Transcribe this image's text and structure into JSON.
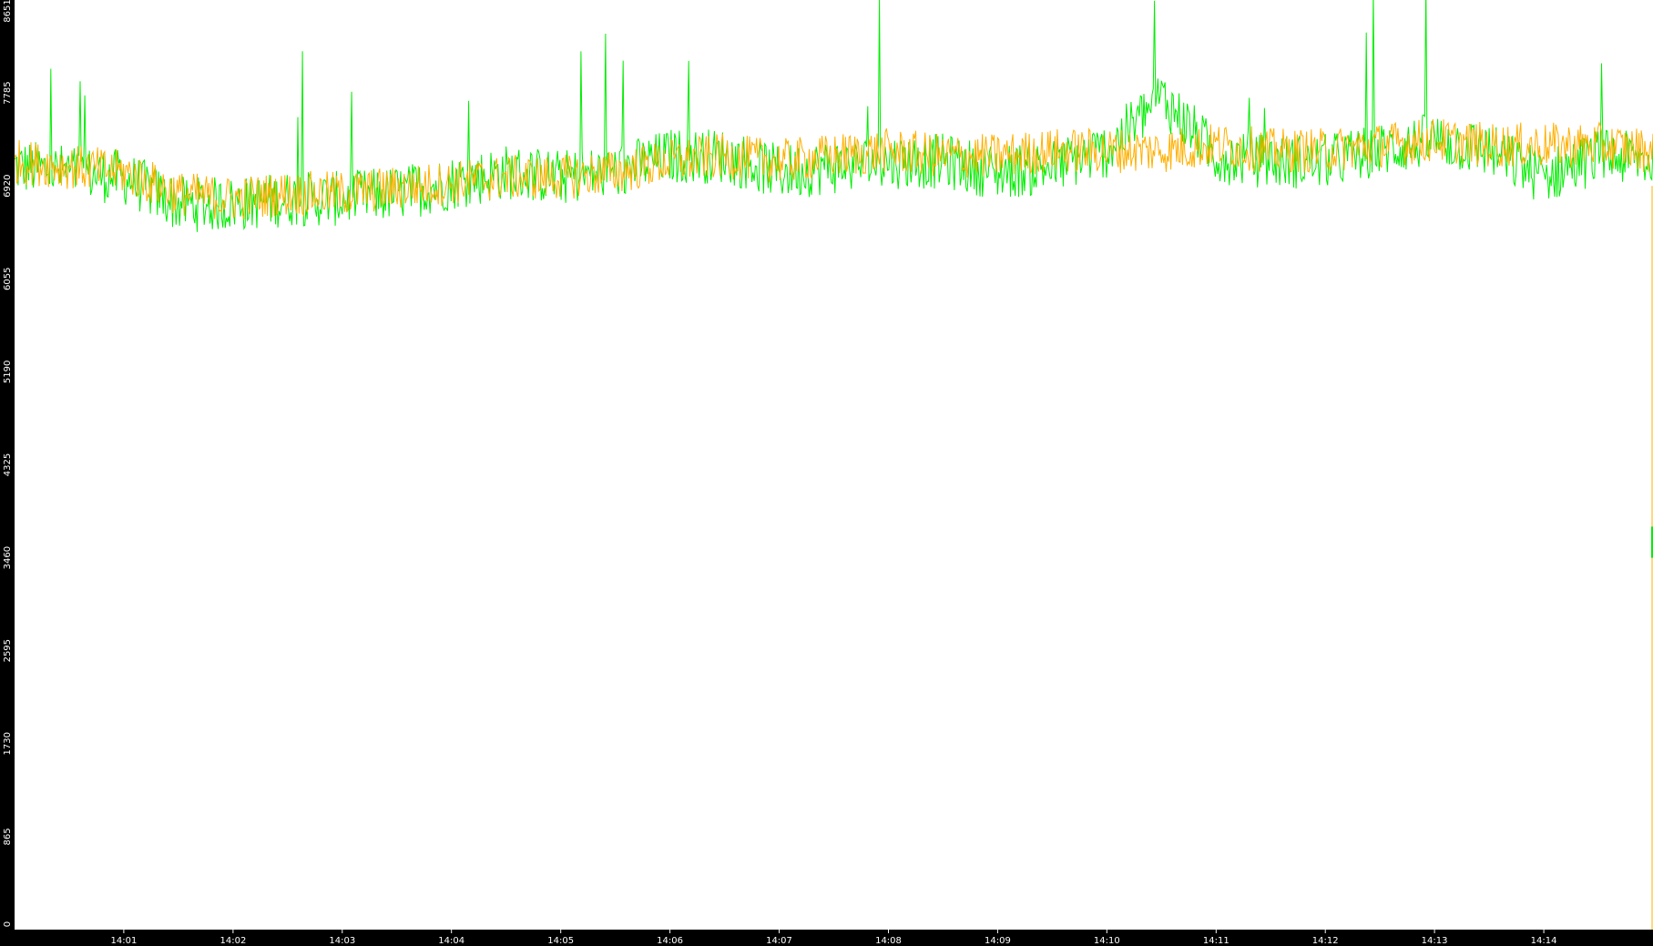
{
  "chart_data": {
    "type": "line",
    "title": "",
    "xlabel": "",
    "ylabel": "",
    "ylim": [
      0,
      8651
    ],
    "xlim": [
      "14:00:00",
      "14:15:00"
    ],
    "grid": false,
    "legend": "none",
    "colors": {
      "background": "#ffffff",
      "frame": "#000000",
      "tick_text": "#ffffff",
      "series_green": "#00ee00",
      "series_orange": "#ffb000"
    },
    "y_ticks": [
      "0",
      "865",
      "1730",
      "2595",
      "3460",
      "4325",
      "5190",
      "6055",
      "6920",
      "7785",
      "8651"
    ],
    "x_ticks": [
      "14:01",
      "14:02",
      "14:03",
      "14:04",
      "14:05",
      "14:06",
      "14:07",
      "14:08",
      "14:09",
      "14:10",
      "14:11",
      "14:12",
      "14:13",
      "14:14"
    ],
    "series": [
      {
        "color": "#00ee00",
        "x": [
          "14:00:00",
          "14:00:30",
          "14:01:00",
          "14:01:30",
          "14:02:00",
          "14:02:30",
          "14:03:00",
          "14:03:30",
          "14:04:00",
          "14:04:30",
          "14:05:00",
          "14:05:30",
          "14:06:00",
          "14:06:30",
          "14:07:00",
          "14:07:30",
          "14:08:00",
          "14:08:30",
          "14:09:00",
          "14:09:30",
          "14:10:00",
          "14:10:30",
          "14:11:00",
          "14:11:30",
          "14:12:00",
          "14:12:30",
          "14:13:00",
          "14:13:30",
          "14:14:00",
          "14:14:30",
          "14:15:00"
        ],
        "values": [
          7100,
          7050,
          7000,
          6750,
          6750,
          6800,
          6800,
          6850,
          6950,
          7050,
          7000,
          7050,
          7200,
          7200,
          7050,
          7100,
          7150,
          7150,
          7050,
          7100,
          7250,
          7750,
          7200,
          7150,
          7150,
          7250,
          7350,
          7250,
          7000,
          7200,
          7150
        ]
      },
      {
        "color": "#ffb000",
        "x": [
          "14:00:00",
          "14:00:30",
          "14:01:00",
          "14:01:30",
          "14:02:00",
          "14:02:30",
          "14:03:00",
          "14:03:30",
          "14:04:00",
          "14:04:30",
          "14:05:00",
          "14:05:30",
          "14:06:00",
          "14:06:30",
          "14:07:00",
          "14:07:30",
          "14:08:00",
          "14:08:30",
          "14:09:00",
          "14:09:30",
          "14:10:00",
          "14:10:30",
          "14:11:00",
          "14:11:30",
          "14:12:00",
          "14:12:30",
          "14:13:00",
          "14:13:30",
          "14:14:00",
          "14:14:30",
          "14:15:00"
        ],
        "values": [
          7150,
          7100,
          7050,
          6850,
          6800,
          6850,
          6850,
          6900,
          6950,
          7000,
          7000,
          7050,
          7150,
          7200,
          7150,
          7200,
          7250,
          7200,
          7200,
          7250,
          7250,
          7250,
          7300,
          7250,
          7250,
          7300,
          7350,
          7300,
          7300,
          7300,
          7250
        ]
      }
    ],
    "end_markers": [
      {
        "color": "#ffb000",
        "from": 6920,
        "to": 0
      },
      {
        "color": "#00ee00",
        "from": 3750,
        "to": 3460
      }
    ]
  }
}
